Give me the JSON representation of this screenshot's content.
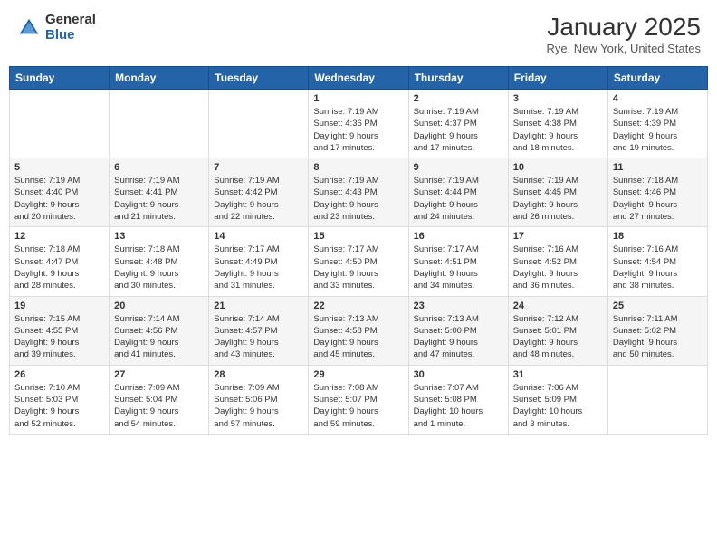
{
  "header": {
    "logo_general": "General",
    "logo_blue": "Blue",
    "month_title": "January 2025",
    "location": "Rye, New York, United States"
  },
  "weekdays": [
    "Sunday",
    "Monday",
    "Tuesday",
    "Wednesday",
    "Thursday",
    "Friday",
    "Saturday"
  ],
  "weeks": [
    [
      {
        "day": "",
        "info": ""
      },
      {
        "day": "",
        "info": ""
      },
      {
        "day": "",
        "info": ""
      },
      {
        "day": "1",
        "info": "Sunrise: 7:19 AM\nSunset: 4:36 PM\nDaylight: 9 hours\nand 17 minutes."
      },
      {
        "day": "2",
        "info": "Sunrise: 7:19 AM\nSunset: 4:37 PM\nDaylight: 9 hours\nand 17 minutes."
      },
      {
        "day": "3",
        "info": "Sunrise: 7:19 AM\nSunset: 4:38 PM\nDaylight: 9 hours\nand 18 minutes."
      },
      {
        "day": "4",
        "info": "Sunrise: 7:19 AM\nSunset: 4:39 PM\nDaylight: 9 hours\nand 19 minutes."
      }
    ],
    [
      {
        "day": "5",
        "info": "Sunrise: 7:19 AM\nSunset: 4:40 PM\nDaylight: 9 hours\nand 20 minutes."
      },
      {
        "day": "6",
        "info": "Sunrise: 7:19 AM\nSunset: 4:41 PM\nDaylight: 9 hours\nand 21 minutes."
      },
      {
        "day": "7",
        "info": "Sunrise: 7:19 AM\nSunset: 4:42 PM\nDaylight: 9 hours\nand 22 minutes."
      },
      {
        "day": "8",
        "info": "Sunrise: 7:19 AM\nSunset: 4:43 PM\nDaylight: 9 hours\nand 23 minutes."
      },
      {
        "day": "9",
        "info": "Sunrise: 7:19 AM\nSunset: 4:44 PM\nDaylight: 9 hours\nand 24 minutes."
      },
      {
        "day": "10",
        "info": "Sunrise: 7:19 AM\nSunset: 4:45 PM\nDaylight: 9 hours\nand 26 minutes."
      },
      {
        "day": "11",
        "info": "Sunrise: 7:18 AM\nSunset: 4:46 PM\nDaylight: 9 hours\nand 27 minutes."
      }
    ],
    [
      {
        "day": "12",
        "info": "Sunrise: 7:18 AM\nSunset: 4:47 PM\nDaylight: 9 hours\nand 28 minutes."
      },
      {
        "day": "13",
        "info": "Sunrise: 7:18 AM\nSunset: 4:48 PM\nDaylight: 9 hours\nand 30 minutes."
      },
      {
        "day": "14",
        "info": "Sunrise: 7:17 AM\nSunset: 4:49 PM\nDaylight: 9 hours\nand 31 minutes."
      },
      {
        "day": "15",
        "info": "Sunrise: 7:17 AM\nSunset: 4:50 PM\nDaylight: 9 hours\nand 33 minutes."
      },
      {
        "day": "16",
        "info": "Sunrise: 7:17 AM\nSunset: 4:51 PM\nDaylight: 9 hours\nand 34 minutes."
      },
      {
        "day": "17",
        "info": "Sunrise: 7:16 AM\nSunset: 4:52 PM\nDaylight: 9 hours\nand 36 minutes."
      },
      {
        "day": "18",
        "info": "Sunrise: 7:16 AM\nSunset: 4:54 PM\nDaylight: 9 hours\nand 38 minutes."
      }
    ],
    [
      {
        "day": "19",
        "info": "Sunrise: 7:15 AM\nSunset: 4:55 PM\nDaylight: 9 hours\nand 39 minutes."
      },
      {
        "day": "20",
        "info": "Sunrise: 7:14 AM\nSunset: 4:56 PM\nDaylight: 9 hours\nand 41 minutes."
      },
      {
        "day": "21",
        "info": "Sunrise: 7:14 AM\nSunset: 4:57 PM\nDaylight: 9 hours\nand 43 minutes."
      },
      {
        "day": "22",
        "info": "Sunrise: 7:13 AM\nSunset: 4:58 PM\nDaylight: 9 hours\nand 45 minutes."
      },
      {
        "day": "23",
        "info": "Sunrise: 7:13 AM\nSunset: 5:00 PM\nDaylight: 9 hours\nand 47 minutes."
      },
      {
        "day": "24",
        "info": "Sunrise: 7:12 AM\nSunset: 5:01 PM\nDaylight: 9 hours\nand 48 minutes."
      },
      {
        "day": "25",
        "info": "Sunrise: 7:11 AM\nSunset: 5:02 PM\nDaylight: 9 hours\nand 50 minutes."
      }
    ],
    [
      {
        "day": "26",
        "info": "Sunrise: 7:10 AM\nSunset: 5:03 PM\nDaylight: 9 hours\nand 52 minutes."
      },
      {
        "day": "27",
        "info": "Sunrise: 7:09 AM\nSunset: 5:04 PM\nDaylight: 9 hours\nand 54 minutes."
      },
      {
        "day": "28",
        "info": "Sunrise: 7:09 AM\nSunset: 5:06 PM\nDaylight: 9 hours\nand 57 minutes."
      },
      {
        "day": "29",
        "info": "Sunrise: 7:08 AM\nSunset: 5:07 PM\nDaylight: 9 hours\nand 59 minutes."
      },
      {
        "day": "30",
        "info": "Sunrise: 7:07 AM\nSunset: 5:08 PM\nDaylight: 10 hours\nand 1 minute."
      },
      {
        "day": "31",
        "info": "Sunrise: 7:06 AM\nSunset: 5:09 PM\nDaylight: 10 hours\nand 3 minutes."
      },
      {
        "day": "",
        "info": ""
      }
    ]
  ]
}
